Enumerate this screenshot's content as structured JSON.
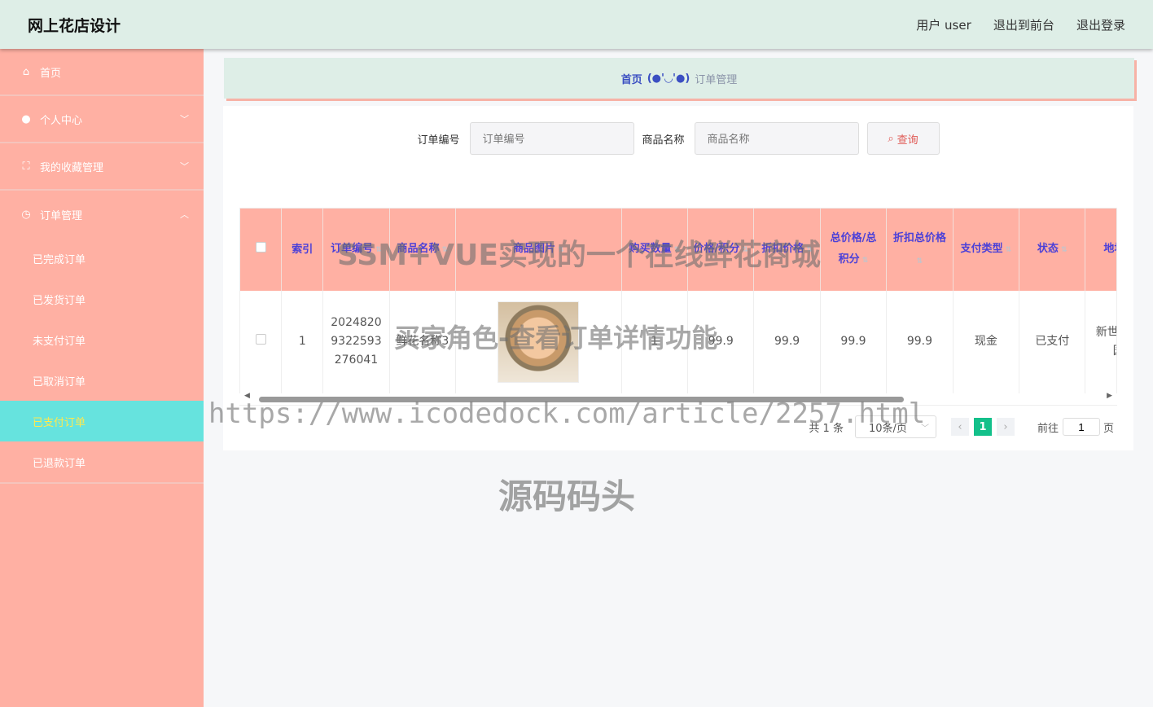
{
  "header": {
    "title": "网上花店设计",
    "nav": [
      "用户 user",
      "退出到前台",
      "退出登录"
    ]
  },
  "sidebar": {
    "items": [
      {
        "label": "首页",
        "icon": "home-icon"
      },
      {
        "label": "个人中心",
        "icon": "user-icon"
      },
      {
        "label": "我的收藏管理",
        "icon": "collection-icon"
      },
      {
        "label": "订单管理",
        "icon": "compass-icon"
      }
    ],
    "sub_items": [
      "已完成订单",
      "已发货订单",
      "未支付订单",
      "已取消订单",
      "已支付订单",
      "已退款订单"
    ],
    "active_sub": "已支付订单"
  },
  "breadcrumb": {
    "home": "首页",
    "sep": "(●'◡'●)",
    "current": "订单管理"
  },
  "search": {
    "order_label": "订单编号",
    "order_placeholder": "订单编号",
    "product_label": "商品名称",
    "product_placeholder": "商品名称",
    "button": "查询"
  },
  "table": {
    "headers": [
      "索引",
      "订单编号",
      "商品名称",
      "商品图片",
      "购买数量",
      "价格/积分",
      "折扣价格",
      "总价格/总积分",
      "折扣总价格",
      "支付类型",
      "状态",
      "地址"
    ],
    "rows": [
      [
        "1",
        "20248209322593276041",
        "鲜花名称3",
        "",
        "1",
        "99.9",
        "99.9",
        "99.9",
        "99.9",
        "现金",
        "已支付",
        "新世纪花园"
      ]
    ]
  },
  "pagination": {
    "total": "共 1 条",
    "page_size": "10条/页",
    "current": "1",
    "goto_label": "前往",
    "goto_value": "1",
    "page_suffix": "页"
  },
  "watermarks": [
    "SSM+VUE实现的一个在线鲜花商城",
    "买家角色-查看订单详情功能",
    "https://www.icodedock.com/article/2257.html",
    "源码码头"
  ]
}
